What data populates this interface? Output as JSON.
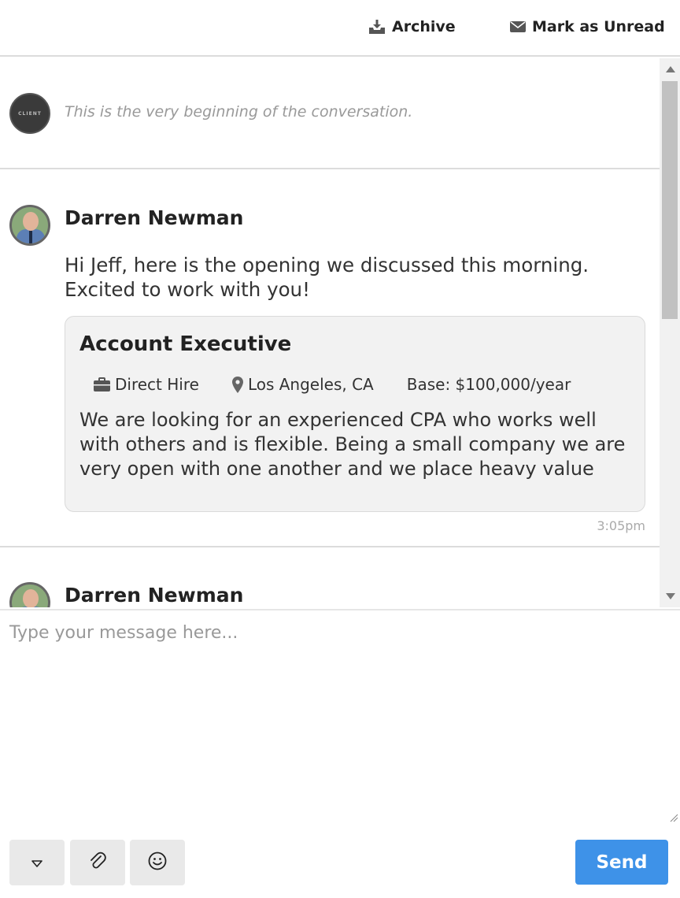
{
  "toolbar": {
    "archive_label": "Archive",
    "mark_unread_label": "Mark as Unread"
  },
  "conversation": {
    "begin_avatar_label": "CLIENT",
    "begin_text": "This is the very beginning of the conversation.",
    "messages": [
      {
        "sender": "Darren Newman",
        "text": "Hi Jeff, here is the opening we discussed this morning. Excited to work with you!",
        "job": {
          "title": "Account Executive",
          "type": "Direct Hire",
          "location": "Los Angeles, CA",
          "pay": "Base: $100,000/year",
          "description": "We are looking for an experienced CPA who works well with others and is flexible. Being a small company we are very open with one another and we place heavy value"
        },
        "time": "3:05pm"
      },
      {
        "sender": "Darren Newman"
      }
    ]
  },
  "composer": {
    "placeholder": "Type your message here...",
    "send_label": "Send"
  },
  "colors": {
    "send_button": "#3e92e8",
    "card_background": "#f2f2f2",
    "divider": "#dcdcdc"
  },
  "icons": [
    "download-tray-icon",
    "envelope-icon",
    "briefcase-icon",
    "map-pin-icon",
    "caret-down-icon",
    "paperclip-icon",
    "smiley-icon"
  ]
}
